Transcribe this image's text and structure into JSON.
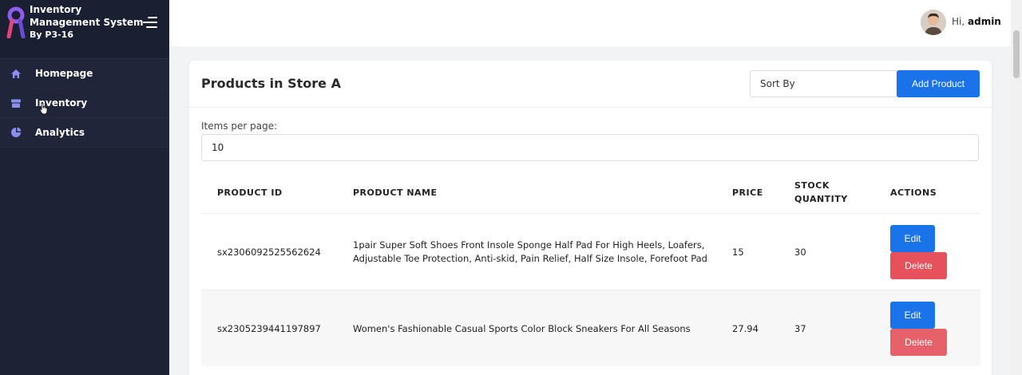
{
  "brand": {
    "title": "Inventory Management System",
    "subtitle": "By P3-16",
    "accent": "#7b4dd8"
  },
  "sidebar": {
    "items": [
      {
        "label": "Homepage",
        "icon": "home-icon"
      },
      {
        "label": "Inventory",
        "icon": "box-icon"
      },
      {
        "label": "Analytics",
        "icon": "pie-chart-icon"
      }
    ]
  },
  "topbar": {
    "greeting": "Hi,",
    "username": "admin"
  },
  "card": {
    "title": "Products in Store A",
    "sort_placeholder": "Sort By",
    "add_label": "Add Product",
    "items_per_page_label": "Items per page:",
    "items_per_page_value": "10"
  },
  "table": {
    "headers": [
      "PRODUCT ID",
      "PRODUCT NAME",
      "PRICE",
      "STOCK QUANTITY",
      "ACTIONS"
    ],
    "rows": [
      {
        "id": "sx2306092525562624",
        "name": "1pair Super Soft Shoes Front Insole Sponge Half Pad For High Heels, Loafers, Adjustable Toe Protection, Anti-skid, Pain Relief, Half Size Insole, Forefoot Pad",
        "price": "15",
        "stock": "30",
        "edit_label": "Edit",
        "delete_label": "Delete"
      },
      {
        "id": "sx2305239441197897",
        "name": "Women's Fashionable Casual Sports Color Block Sneakers For All Seasons",
        "price": "27.94",
        "stock": "37",
        "edit_label": "Edit",
        "delete_label": "Delete"
      }
    ]
  },
  "colors": {
    "sidebar_bg": "#1d2235",
    "primary": "#1a73e8",
    "danger": "#e6515c"
  }
}
